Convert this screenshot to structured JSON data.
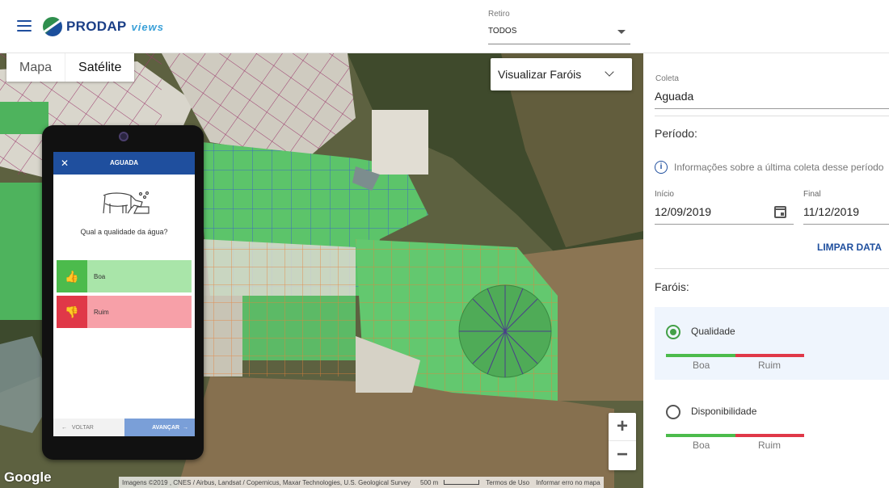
{
  "header": {
    "logo_text": "PRODAP",
    "logo_sub": "views",
    "retiro_label": "Retiro",
    "retiro_value": "TODOS"
  },
  "map": {
    "type_map": "Mapa",
    "type_satellite": "Satélite",
    "farois_dropdown": "Visualizar Faróis",
    "zoom_in": "+",
    "zoom_out": "−",
    "google": "Google",
    "attribution": "Imagens ©2019 , CNES / Airbus, Landsat / Copernicus, Maxar Technologies, U.S. Geological Survey",
    "scale": "500 m",
    "terms": "Termos de Uso",
    "report": "Informar erro no mapa"
  },
  "phone": {
    "title": "AGUADA",
    "close": "✕",
    "question": "Qual a qualidade da água?",
    "options": [
      {
        "label": "Boa"
      },
      {
        "label": "Ruim"
      }
    ],
    "back": "VOLTAR",
    "next": "AVANÇAR"
  },
  "panel": {
    "coleta_label": "Coleta",
    "coleta_value": "Aguada",
    "periodo_label": "Período:",
    "info_text": "Informações sobre a última coleta desse período",
    "inicio_label": "Início",
    "inicio_value": "12/09/2019",
    "final_label": "Final",
    "final_value": "11/12/2019",
    "limpar": "LIMPAR DATA",
    "farois_label": "Faróis:",
    "farois": [
      {
        "name": "Qualidade",
        "selected": true,
        "good": "Boa",
        "bad": "Ruim"
      },
      {
        "name": "Disponibilidade",
        "selected": false,
        "good": "Boa",
        "bad": "Ruim"
      }
    ]
  },
  "colors": {
    "brand_blue": "#1f4f9e",
    "good": "#4cbb4c",
    "bad": "#e03848",
    "pasture_green": "#5cc46a"
  }
}
